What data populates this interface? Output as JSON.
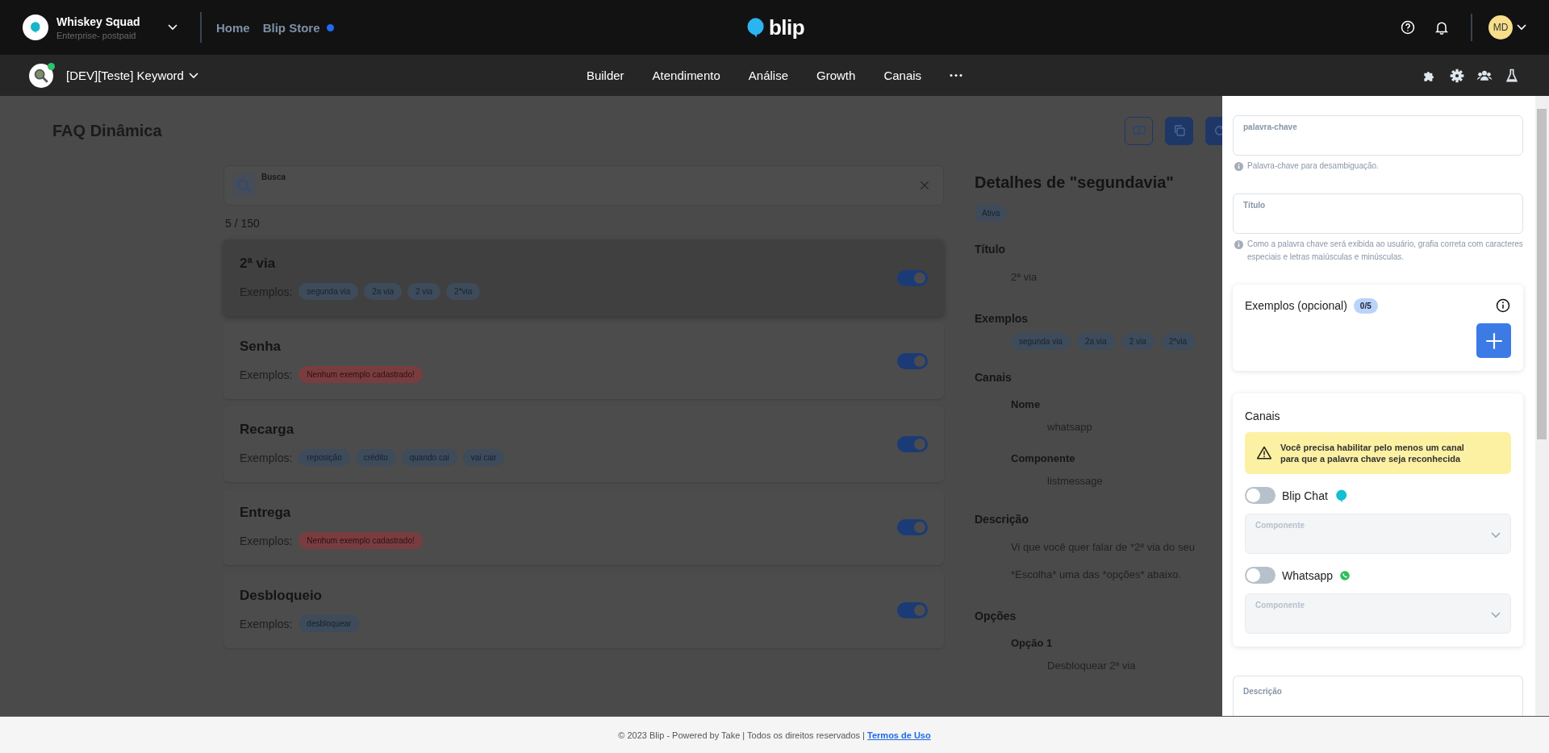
{
  "top_bar": {
    "org_name": "Whiskey Squad",
    "org_plan": "Enterprise- postpaid",
    "links": [
      {
        "label": "Home",
        "badge": false
      },
      {
        "label": "Blip Store",
        "badge": true
      }
    ],
    "logo_text": "blip",
    "avatar_initials": "MD"
  },
  "bot_bar": {
    "bot_name": "[DEV][Teste] Keyword",
    "online": true,
    "nav": [
      {
        "label": "Builder"
      },
      {
        "label": "Atendimento"
      },
      {
        "label": "Análise"
      },
      {
        "label": "Growth"
      },
      {
        "label": "Canais"
      }
    ]
  },
  "page": {
    "title": "FAQ Dinâmica"
  },
  "search": {
    "placeholder": "Busca"
  },
  "count": "5 / 150",
  "keywords": [
    {
      "title": "2ª via",
      "examples_label": "Exemplos:",
      "selected": true,
      "enabled": true,
      "chips": [
        {
          "text": "segunda via",
          "kind": "tag"
        },
        {
          "text": "2a via",
          "kind": "tag"
        },
        {
          "text": "2 via",
          "kind": "tag"
        },
        {
          "text": "2*via",
          "kind": "tag"
        }
      ]
    },
    {
      "title": "Senha",
      "examples_label": "Exemplos:",
      "selected": false,
      "enabled": true,
      "chips": [
        {
          "text": "Nenhum exemplo cadastrado!",
          "kind": "empty"
        }
      ]
    },
    {
      "title": "Recarga",
      "examples_label": "Exemplos:",
      "selected": false,
      "enabled": true,
      "chips": [
        {
          "text": "reposição",
          "kind": "tag"
        },
        {
          "text": "crédito",
          "kind": "tag"
        },
        {
          "text": "quando cai",
          "kind": "tag"
        },
        {
          "text": "vai cair",
          "kind": "tag"
        }
      ]
    },
    {
      "title": "Entrega",
      "examples_label": "Exemplos:",
      "selected": false,
      "enabled": true,
      "chips": [
        {
          "text": "Nenhum exemplo cadastrado!",
          "kind": "empty"
        }
      ]
    },
    {
      "title": "Desbloqueio",
      "examples_label": "Exemplos:",
      "selected": false,
      "enabled": true,
      "chips": [
        {
          "text": "desbloquear",
          "kind": "tag"
        }
      ]
    }
  ],
  "details": {
    "heading": "Detalhes de \"segundavia\"",
    "status": "Ativa",
    "sections": [
      {
        "label": "Título",
        "kind": "text",
        "lines": [
          "2ª via"
        ]
      },
      {
        "label": "Exemplos",
        "kind": "chips",
        "chips": [
          "segunda via",
          "2a via",
          "2 via",
          "2*via"
        ]
      },
      {
        "label": "Canais",
        "kind": "fields",
        "fields": [
          {
            "label": "Nome",
            "value": "whatsapp"
          },
          {
            "label": "Componente",
            "value": "listmessage"
          }
        ]
      },
      {
        "label": "Descrição",
        "kind": "text",
        "lines": [
          "Vi que você quer falar de *2ª via do seu",
          "*Escolha* uma das *opções* abaixo."
        ]
      },
      {
        "label": "Opções",
        "kind": "fields",
        "fields": [
          {
            "label": "Opção 1",
            "value": "Desbloquear 2ª via"
          }
        ]
      }
    ]
  },
  "panel": {
    "keyword_field": {
      "label": "palavra-chave",
      "help": "Palavra-chave para desambiguação."
    },
    "title_field": {
      "label": "Título",
      "help": "Como a palavra chave será exibida ao usuário, grafia correta com caracteres especiais e letras maiúsculas e minúsculas."
    },
    "examples": {
      "title": "Exemplos (opcional)",
      "count": "0/5"
    },
    "channels": {
      "title": "Canais",
      "warning": "Você precisa habilitar pelo menos um canal para que a palavra chave seja reconhecida",
      "items": [
        {
          "name": "Blip Chat",
          "kind": "blip-chat",
          "on": false,
          "component_label": "Componente"
        },
        {
          "name": "Whatsapp",
          "kind": "whatsapp",
          "on": false,
          "component_label": "Componente"
        }
      ]
    },
    "description_field": {
      "label": "Descrição"
    }
  },
  "footer": {
    "text": "© 2023 Blip - Powered by Take | Todos os direitos reservados |",
    "link": "Termos de Uso"
  }
}
